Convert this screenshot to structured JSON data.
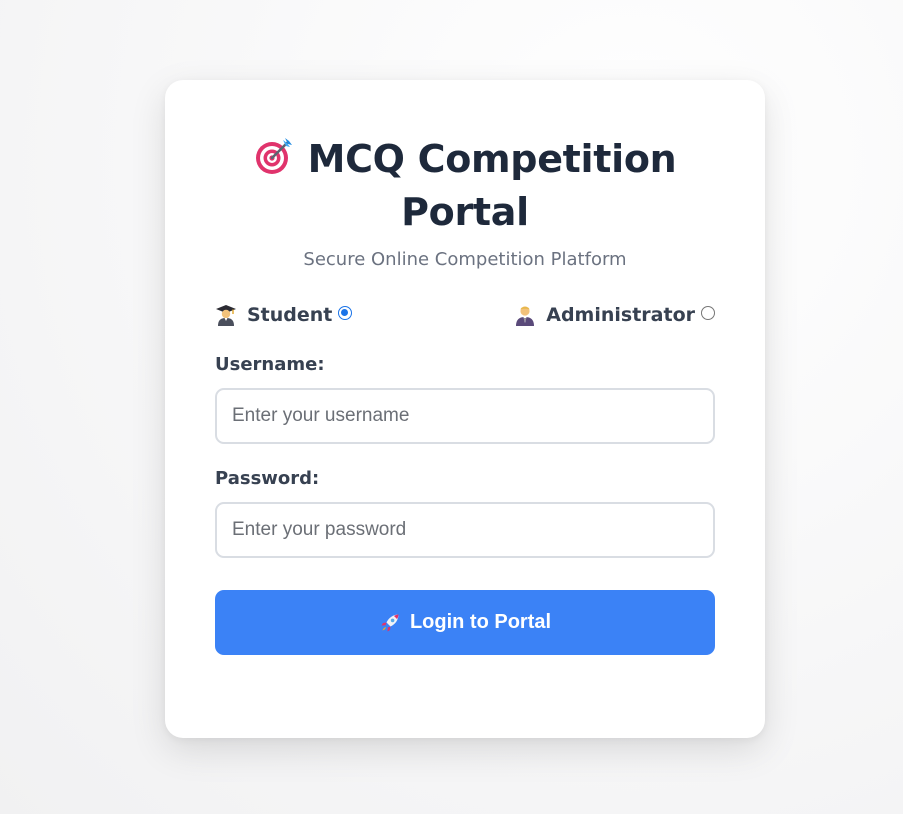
{
  "header": {
    "title": "MCQ Competition Portal",
    "title_icon": "target-icon",
    "subtitle": "Secure Online Competition Platform"
  },
  "roles": [
    {
      "label": "Student",
      "icon": "student-icon",
      "selected": true
    },
    {
      "label": "Administrator",
      "icon": "administrator-icon",
      "selected": false
    }
  ],
  "form": {
    "username_label": "Username:",
    "username_placeholder": "Enter your username",
    "username_value": "",
    "password_label": "Password:",
    "password_placeholder": "Enter your password",
    "password_value": ""
  },
  "login_button": {
    "label": "Login to Portal",
    "icon": "rocket-icon"
  },
  "colors": {
    "primary": "#3b82f6",
    "radio_selected": "#1a73e8",
    "title_text": "#1e293b",
    "subtitle_text": "#6b7280",
    "input_border": "#d9dde3"
  }
}
